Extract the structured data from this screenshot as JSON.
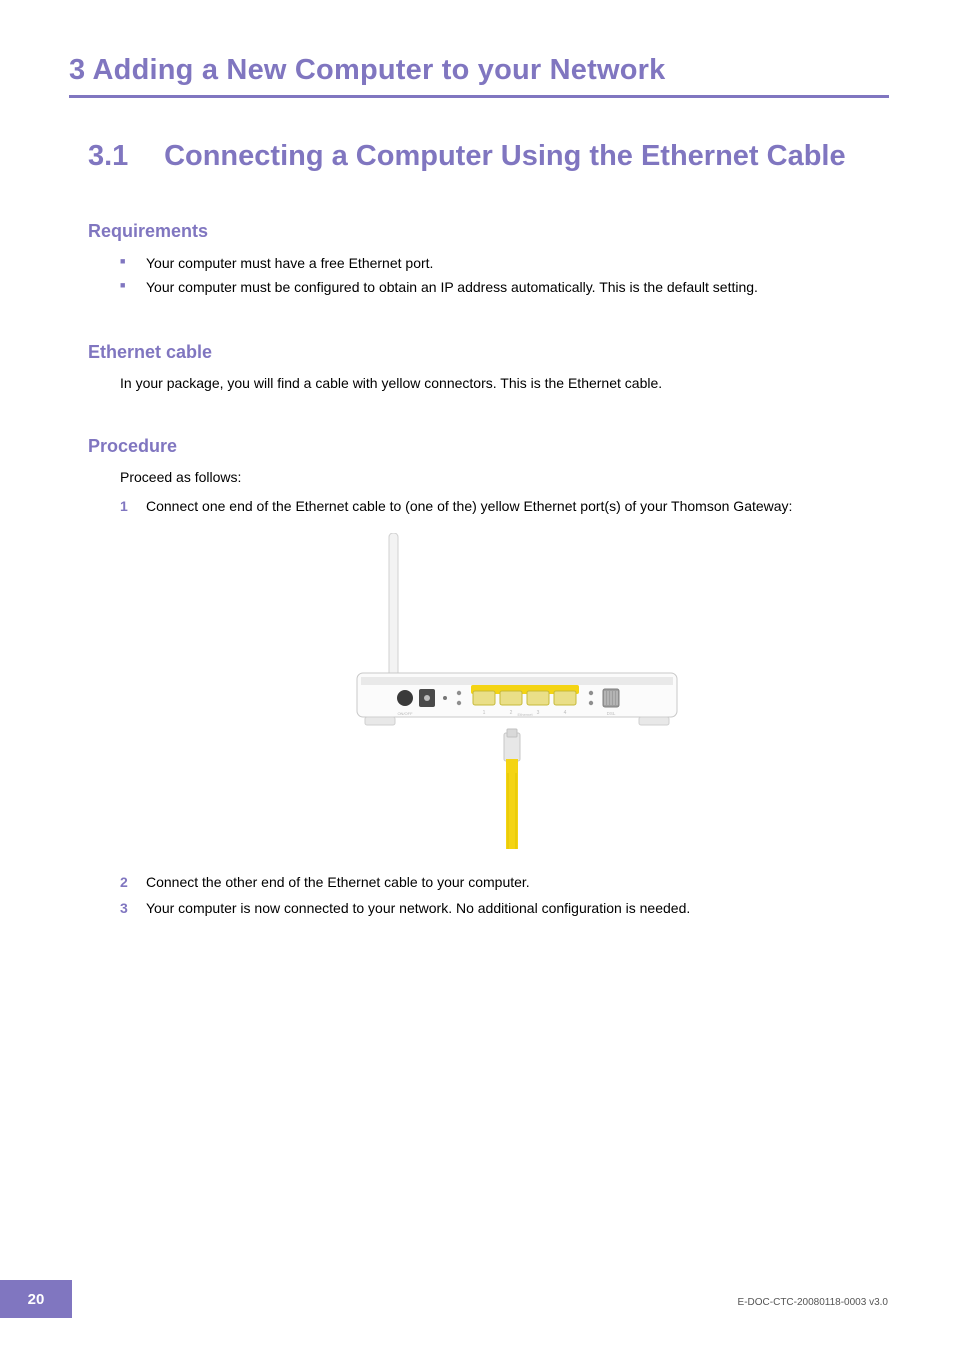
{
  "chapter": {
    "number": "3",
    "title": "Adding a New Computer to your Network"
  },
  "section": {
    "number": "3.1",
    "title": "Connecting a Computer Using the Ethernet Cable"
  },
  "requirements": {
    "heading": "Requirements",
    "items": [
      "Your computer must have a free Ethernet port.",
      "Your computer must be configured to obtain an IP address automatically. This is the default setting."
    ]
  },
  "ethernet_cable": {
    "heading": "Ethernet cable",
    "text": "In your package, you will find a cable with yellow connectors. This is the Ethernet cable."
  },
  "procedure": {
    "heading": "Procedure",
    "intro": "Proceed as follows:",
    "steps": [
      "Connect one end of the Ethernet cable to (one of the) yellow Ethernet port(s) of your Thomson Gateway:",
      "Connect the other end of the Ethernet cable to your computer.",
      "Your computer is now connected to your network. No additional configuration is needed."
    ]
  },
  "figure": {
    "description": "router-rear-with-ethernet-cable",
    "port_labels": {
      "power": "ON/OFF",
      "eth1": "1",
      "eth2": "2",
      "eth_icon": "Ethernet",
      "eth3": "3",
      "eth4": "4",
      "dsl": "DSL"
    }
  },
  "footer": {
    "page_number": "20",
    "doc_id": "E-DOC-CTC-20080118-0003 v3.0"
  }
}
